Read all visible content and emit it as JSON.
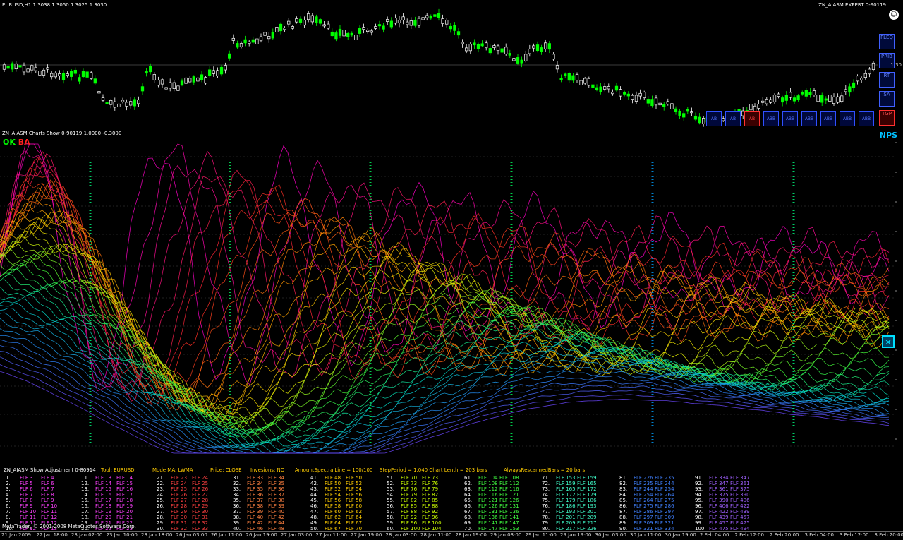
{
  "price_pane": {
    "header": "EURUSD,H1  1.3038  1.3050  1.3025  1.3030",
    "expert_label": "ZN_AIASM EXPERT 0-90119",
    "side_buttons": [
      {
        "label": "FLEQ",
        "red": false
      },
      {
        "label": "PRIB",
        "red": false
      },
      {
        "label": "RT",
        "red": false
      },
      {
        "label": "SA",
        "red": false
      },
      {
        "label": "TGP",
        "red": true
      }
    ],
    "bottom_buttons": [
      {
        "label": "AB",
        "red": false
      },
      {
        "label": "AB",
        "red": false
      },
      {
        "label": "AB",
        "red": true
      },
      {
        "label": "ABB",
        "red": false
      },
      {
        "label": "ABB",
        "red": false
      },
      {
        "label": "ABB",
        "red": false
      },
      {
        "label": "ABB",
        "red": false
      },
      {
        "label": "ABB",
        "red": false
      },
      {
        "label": "ABB",
        "red": false
      }
    ]
  },
  "spectral_pane": {
    "header": "ZN_AIASM Charts Show 0-90119 1.0000 -0.3000",
    "ok_label": "OK",
    "ba_label": "BA",
    "nps_label": "NPS",
    "close_icon": "x-box-icon"
  },
  "table_pane": {
    "header_items": [
      {
        "text": "ZN_AIASM Show Adjustment 0-80914",
        "color": "#ffffff"
      },
      {
        "text": "Tool: EURUSD",
        "color": "#ffcc00"
      },
      {
        "text": "Mode MA: LWMA",
        "color": "#ffcc00"
      },
      {
        "text": "Price: CLOSE",
        "color": "#ffcc00"
      },
      {
        "text": "Invesions: NO",
        "color": "#ffcc00"
      },
      {
        "text": "AmountSpectralLine = 100/100",
        "color": "#ffcc00"
      },
      {
        "text": "StepPeriod = 1.040 Chart Lenth = 203 bars",
        "color": "#ffcc00"
      },
      {
        "text": "AlwaysRescannedBars = 20 bars",
        "color": "#ffcc00"
      }
    ],
    "rows": [
      [
        "1.",
        "FLF 3",
        "FLF 4",
        "11.",
        "FLF 13",
        "FLF 14",
        "21.",
        "FLF 23",
        "FLF 24",
        "31.",
        "FLF 33",
        "FLF 34",
        "41.",
        "FLF 48",
        "FLF 50",
        "51.",
        "FLF 70",
        "FLF 73",
        "61.",
        "FLF 104",
        "FLF 108",
        "71.",
        "FLF 153",
        "FLF 159",
        "81.",
        "FLF 226",
        "FLF 235",
        "91.",
        "FLF 334",
        "FLF 347"
      ],
      [
        "2.",
        "FLF 5",
        "FLF 6",
        "12.",
        "FLF 14",
        "FLF 15",
        "22.",
        "FLF 24",
        "FLF 25",
        "32.",
        "FLF 34",
        "FLF 35",
        "42.",
        "FLF 50",
        "FLF 52",
        "52.",
        "FLF 73",
        "FLF 76",
        "62.",
        "FLF 108",
        "FLF 112",
        "72.",
        "FLF 159",
        "FLF 165",
        "82.",
        "FLF 235",
        "FLF 244",
        "92.",
        "FLF 347",
        "FLF 361"
      ],
      [
        "3.",
        "FLF 6",
        "FLF 7",
        "13.",
        "FLF 15",
        "FLF 16",
        "23.",
        "FLF 25",
        "FLF 26",
        "33.",
        "FLF 35",
        "FLF 36",
        "43.",
        "FLF 52",
        "FLF 54",
        "53.",
        "FLF 76",
        "FLF 79",
        "63.",
        "FLF 112",
        "FLF 116",
        "73.",
        "FLF 165",
        "FLF 172",
        "83.",
        "FLF 244",
        "FLF 254",
        "93.",
        "FLF 361",
        "FLF 375"
      ],
      [
        "4.",
        "FLF 7",
        "FLF 8",
        "14.",
        "FLF 16",
        "FLF 17",
        "24.",
        "FLF 26",
        "FLF 27",
        "34.",
        "FLF 36",
        "FLF 37",
        "44.",
        "FLF 54",
        "FLF 56",
        "54.",
        "FLF 79",
        "FLF 82",
        "64.",
        "FLF 116",
        "FLF 121",
        "74.",
        "FLF 172",
        "FLF 179",
        "84.",
        "FLF 254",
        "FLF 264",
        "94.",
        "FLF 375",
        "FLF 390"
      ],
      [
        "5.",
        "FLF 8",
        "FLF 9",
        "15.",
        "FLF 17",
        "FLF 18",
        "25.",
        "FLF 27",
        "FLF 28",
        "35.",
        "FLF 37",
        "FLF 38",
        "45.",
        "FLF 56",
        "FLF 58",
        "55.",
        "FLF 82",
        "FLF 85",
        "65.",
        "FLF 121",
        "FLF 126",
        "75.",
        "FLF 179",
        "FLF 186",
        "85.",
        "FLF 264",
        "FLF 275",
        "95.",
        "FLF 390",
        "FLF 406"
      ],
      [
        "6.",
        "FLF 9",
        "FLF 10",
        "16.",
        "FLF 18",
        "FLF 19",
        "26.",
        "FLF 28",
        "FLF 29",
        "36.",
        "FLF 38",
        "FLF 39",
        "46.",
        "FLF 58",
        "FLF 60",
        "56.",
        "FLF 85",
        "FLF 88",
        "66.",
        "FLF 126",
        "FLF 131",
        "76.",
        "FLF 186",
        "FLF 193",
        "86.",
        "FLF 275",
        "FLF 286",
        "96.",
        "FLF 406",
        "FLF 422"
      ],
      [
        "7.",
        "FLF 10",
        "FLF 11",
        "17.",
        "FLF 19",
        "FLF 20",
        "27.",
        "FLF 29",
        "FLF 30",
        "37.",
        "FLF 39",
        "FLF 40",
        "47.",
        "FLF 60",
        "FLF 62",
        "57.",
        "FLF 88",
        "FLF 92",
        "67.",
        "FLF 131",
        "FLF 136",
        "77.",
        "FLF 193",
        "FLF 201",
        "87.",
        "FLF 286",
        "FLF 297",
        "97.",
        "FLF 422",
        "FLF 439"
      ],
      [
        "8.",
        "FLF 11",
        "FLF 12",
        "18.",
        "FLF 20",
        "FLF 21",
        "28.",
        "FLF 30",
        "FLF 31",
        "38.",
        "FLF 40",
        "FLF 42",
        "48.",
        "FLF 62",
        "FLF 64",
        "58.",
        "FLF 92",
        "FLF 96",
        "68.",
        "FLF 136",
        "FLF 141",
        "78.",
        "FLF 201",
        "FLF 209",
        "88.",
        "FLF 297",
        "FLF 309",
        "98.",
        "FLF 439",
        "FLF 457"
      ],
      [
        "9.",
        "FLF 11",
        "FLF 12",
        "19.",
        "FLF 21",
        "FLF 22",
        "29.",
        "FLF 31",
        "FLF 32",
        "39.",
        "FLF 42",
        "FLF 44",
        "49.",
        "FLF 64",
        "FLF 67",
        "59.",
        "FLF 96",
        "FLF 100",
        "69.",
        "FLF 141",
        "FLF 147",
        "79.",
        "FLF 209",
        "FLF 217",
        "89.",
        "FLF 309",
        "FLF 321",
        "99.",
        "FLF 457",
        "FLF 475"
      ],
      [
        "10.",
        "FLF 12",
        "FLF 13",
        "20.",
        "FLF 22",
        "FLF 23",
        "30.",
        "FLF 32",
        "FLF 33",
        "40.",
        "FLF 46",
        "FLF 48",
        "50.",
        "FLF 67",
        "FLF 70",
        "60.",
        "FLF 100",
        "FLF 104",
        "70.",
        "FLF 147",
        "FLF 153",
        "80.",
        "FLF 217",
        "FLF 226",
        "90.",
        "FLF 321",
        "FLF 334",
        "100.",
        "FLF 475",
        "FLF 494"
      ]
    ],
    "footer": "MetaTrader, © 2001-2008 MetaQuotes Software Corp."
  },
  "time_axis": {
    "labels": [
      "21 Jan 2009",
      "22 Jan 18:00",
      "23 Jan 02:00",
      "23 Jan 10:00",
      "23 Jan 18:00",
      "26 Jan 03:00",
      "26 Jan 11:00",
      "26 Jan 19:00",
      "27 Jan 03:00",
      "27 Jan 11:00",
      "27 Jan 19:00",
      "28 Jan 03:00",
      "28 Jan 11:00",
      "28 Jan 19:00",
      "29 Jan 03:00",
      "29 Jan 11:00",
      "29 Jan 19:00",
      "30 Jan 03:00",
      "30 Jan 11:00",
      "30 Jan 19:00",
      "2 Feb 04:00",
      "2 Feb 12:00",
      "2 Feb 20:00",
      "3 Feb 04:00",
      "3 Feb 12:00",
      "3 Feb 20:00"
    ]
  },
  "colors": {
    "bull_candle": "#00ff00",
    "bear_candle": "#ffffff",
    "ok": "#00ff00",
    "ba": "#ff2020",
    "nps": "#00c0ff"
  }
}
